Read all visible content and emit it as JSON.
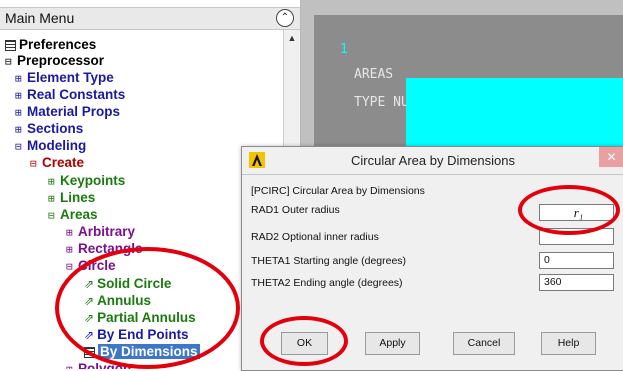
{
  "menu": {
    "title": "Main Menu",
    "collapse_icon": "double-chevron-up-icon",
    "items": [
      {
        "label": "Preferences",
        "expander": "",
        "color": "#000000"
      },
      {
        "label": "Preprocessor",
        "expander": "⊟",
        "color": "#000000"
      },
      {
        "label": "Element Type",
        "expander": "⊞",
        "color": "#1a1aa0"
      },
      {
        "label": "Real Constants",
        "expander": "⊞",
        "color": "#1a1aa0"
      },
      {
        "label": "Material Props",
        "expander": "⊞",
        "color": "#1a1aa0"
      },
      {
        "label": "Sections",
        "expander": "⊞",
        "color": "#1a1aa0"
      },
      {
        "label": "Modeling",
        "expander": "⊟",
        "color": "#1a1aa0"
      },
      {
        "label": "Create",
        "expander": "⊟",
        "color": "#b00000"
      },
      {
        "label": "Keypoints",
        "expander": "⊞",
        "color": "#1a7a10"
      },
      {
        "label": "Lines",
        "expander": "⊞",
        "color": "#1a7a10"
      },
      {
        "label": "Areas",
        "expander": "⊟",
        "color": "#1a7a10"
      },
      {
        "label": "Arbitrary",
        "expander": "⊞",
        "color": "#7a1090"
      },
      {
        "label": "Rectangle",
        "expander": "⊞",
        "color": "#7a1090"
      },
      {
        "label": "Circle",
        "expander": "⊟",
        "color": "#7a1090"
      },
      {
        "label": "Solid Circle",
        "expander": "⇗",
        "color": "#1a7a10"
      },
      {
        "label": "Annulus",
        "expander": "⇗",
        "color": "#1a7a10"
      },
      {
        "label": "Partial Annulus",
        "expander": "⇗",
        "color": "#1a7a10"
      },
      {
        "label": "By End Points",
        "expander": "⇗",
        "color": "#1a1aa0"
      },
      {
        "label": "By Dimensions",
        "expander": "",
        "color": "#ffffff",
        "selected": true
      },
      {
        "label": "Polygon",
        "expander": "⊞",
        "color": "#7a1090"
      }
    ]
  },
  "graphics": {
    "window_number": "1",
    "line1": "AREAS",
    "line2": "TYPE NUM",
    "area_color": "#00ffff"
  },
  "dialog": {
    "title": "Circular Area by Dimensions",
    "command": "[PCIRC]  Circular Area by Dimensions",
    "rows": [
      {
        "label": "RAD1   Outer radius",
        "value": "r₁"
      },
      {
        "label": "RAD2   Optional inner radius",
        "value": ""
      },
      {
        "label": "THETA1  Starting angle (degrees)",
        "value": "0"
      },
      {
        "label": "THETA2  Ending angle (degrees)",
        "value": "360"
      }
    ],
    "buttons": {
      "ok": "OK",
      "apply": "Apply",
      "cancel": "Cancel",
      "help": "Help"
    },
    "close_icon": "close-icon"
  },
  "annotation_color": "#e2000c"
}
